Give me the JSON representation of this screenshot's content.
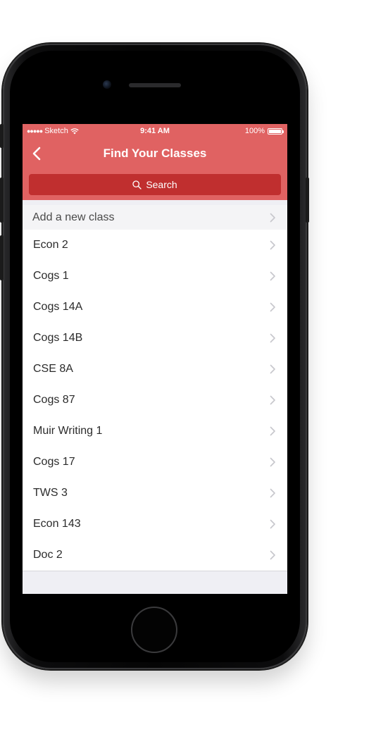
{
  "status_bar": {
    "carrier": "Sketch",
    "time": "9:41 AM",
    "battery": "100%",
    "battery_level": 1.0
  },
  "nav": {
    "title": "Find Your Classes",
    "back_icon": "chevron-left-icon"
  },
  "search": {
    "placeholder": "Search",
    "icon": "search-icon"
  },
  "add_class": {
    "label": "Add a new class"
  },
  "classes": [
    {
      "label": "Econ 2"
    },
    {
      "label": "Cogs 1"
    },
    {
      "label": "Cogs 14A"
    },
    {
      "label": "Cogs 14B"
    },
    {
      "label": "CSE 8A"
    },
    {
      "label": "Cogs 87"
    },
    {
      "label": "Muir Writing 1"
    },
    {
      "label": "Cogs 17"
    },
    {
      "label": "TWS 3"
    },
    {
      "label": "Econ 143"
    },
    {
      "label": "Doc 2"
    }
  ],
  "colors": {
    "accent": "#e06262",
    "search_bg": "#c02f2f",
    "chevron": "#c7c7cc"
  }
}
